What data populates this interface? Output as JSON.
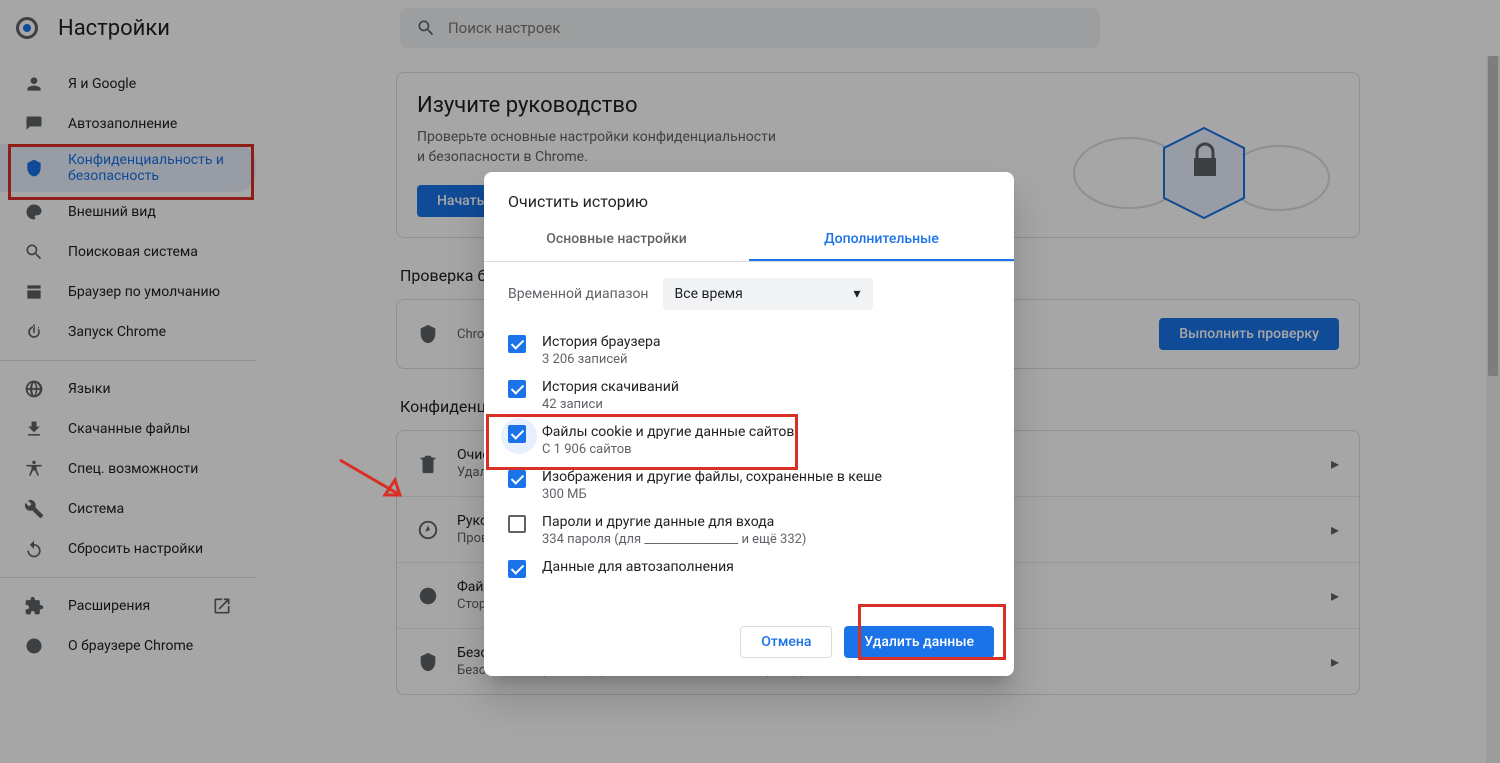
{
  "header": {
    "title": "Настройки",
    "search_placeholder": "Поиск настроек"
  },
  "sidebar": {
    "items": [
      {
        "label": "Я и Google"
      },
      {
        "label": "Автозаполнение"
      },
      {
        "label": "Конфиденциальность и безопасность"
      },
      {
        "label": "Внешний вид"
      },
      {
        "label": "Поисковая система"
      },
      {
        "label": "Браузер по умолчанию"
      },
      {
        "label": "Запуск Chrome"
      }
    ],
    "adv": [
      {
        "label": "Языки"
      },
      {
        "label": "Скачанные файлы"
      },
      {
        "label": "Спец. возможности"
      },
      {
        "label": "Система"
      },
      {
        "label": "Сбросить настройки"
      }
    ],
    "extensions": "Расширения",
    "about": "О браузере Chrome"
  },
  "guide": {
    "title": "Изучите руководство",
    "sub": "Проверьте основные настройки конфиденциальности и безопасности в Chrome.",
    "button": "Начать"
  },
  "safety_check": {
    "heading": "Проверка безопасности",
    "text": "Chrome поможет защитить вас от утечек данных, небезопасных расширений и т. д.",
    "button": "Выполнить проверку"
  },
  "privacy_section": {
    "heading": "Конфиденциальность и безопасность",
    "rows": [
      {
        "title": "Очистить историю",
        "sub": "Удалить файлы cookie и данные сайтов, очистить историю и кеш"
      },
      {
        "title": "Руководство по конфиденциальности",
        "sub": "Проверьте основные настройки конфиденциальности и безопасности"
      },
      {
        "title": "Файлы cookie и другие данные сайтов",
        "sub": "Сторонние файлы cookie заблокированы в режиме инкогнито"
      },
      {
        "title": "Безопасность",
        "sub": "Безопасный просмотр (защита от опасных сайтов) и другие настройки безопасности"
      }
    ]
  },
  "modal": {
    "title": "Очистить историю",
    "tab_basic": "Основные настройки",
    "tab_adv": "Дополнительные",
    "range_label": "Временной диапазон",
    "range_value": "Все время",
    "options": [
      {
        "title": "История браузера",
        "sub": "3 206 записей",
        "checked": true
      },
      {
        "title": "История скачиваний",
        "sub": "42 записи",
        "checked": true
      },
      {
        "title": "Файлы cookie и другие данные сайтов",
        "sub": "С 1 906 сайтов",
        "checked": true
      },
      {
        "title": "Изображения и другие файлы, сохраненные в кеше",
        "sub": "300 МБ",
        "checked": true
      },
      {
        "title": "Пароли и другие данные для входа",
        "sub": "334 пароля (для ________________ и ещё 332)",
        "checked": false
      },
      {
        "title": "Данные для автозаполнения",
        "sub": "",
        "checked": true
      }
    ],
    "cancel": "Отмена",
    "confirm": "Удалить данные"
  }
}
